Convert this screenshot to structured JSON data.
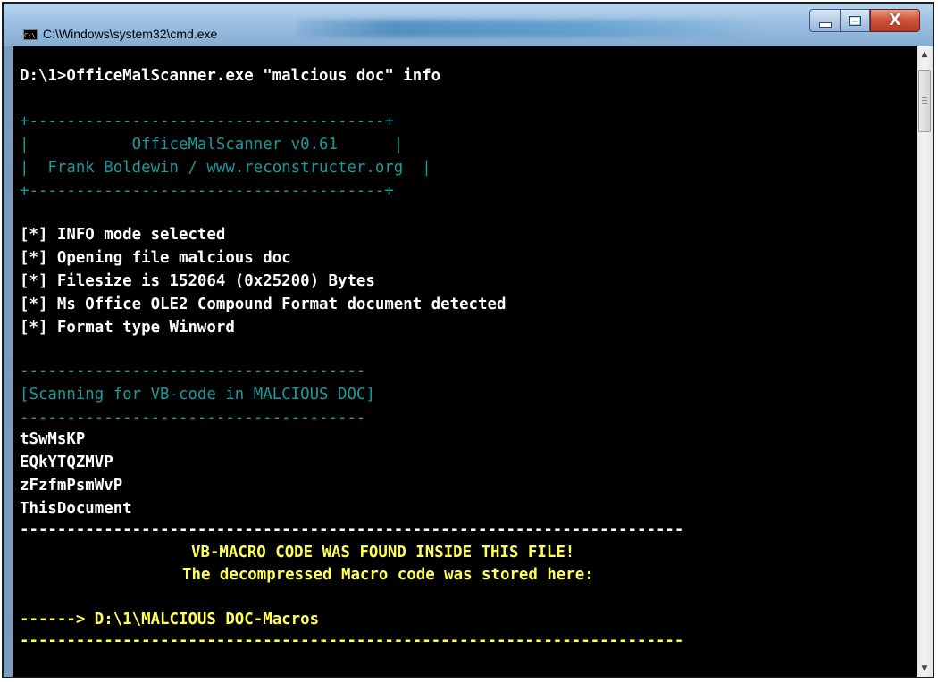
{
  "window": {
    "title": "C:\\Windows\\system32\\cmd.exe",
    "icon": "cmd-icon",
    "icon_text": "C:\\."
  },
  "controls": {
    "minimize_icon": "minimize-icon",
    "maximize_icon": "maximize-icon",
    "close_icon": "close-icon",
    "close_glyph": "X"
  },
  "scrollbar": {
    "up_arrow": "▲",
    "down_arrow": "▼"
  },
  "colors": {
    "console_bg": "#000000",
    "text": "#ffffff",
    "banner": "#1a9a9a",
    "highlight": "#ffff55"
  },
  "console": {
    "command": "D:\\1>OfficeMalScanner.exe \"malcious doc\" info",
    "banner": {
      "border_top": "+--------------------------------------+",
      "line1": "|           OfficeMalScanner v0.61      |",
      "line2": "|  Frank Boldewin / www.reconstructer.org  |",
      "border_bottom": "+--------------------------------------+"
    },
    "info_lines": [
      "[*] INFO mode selected",
      "[*] Opening file malcious doc",
      "[*] Filesize is 152064 (0x25200) Bytes",
      "[*] Ms Office OLE2 Compound Format document detected",
      "[*] Format type Winword"
    ],
    "scan_separator": "-------------------------------------",
    "scan_header": "[Scanning for VB-code in MALCIOUS DOC]",
    "modules": [
      "tSwMsKP",
      "EQkYTQZMVP",
      "zFzfmPsmWvP",
      "ThisDocument"
    ],
    "long_separator": "-----------------------------------------------------------------------",
    "found_message": "VB-MACRO CODE WAS FOUND INSIDE THIS FILE!",
    "stored_message": "The decompressed Macro code was stored here:",
    "output_path": "------> D:\\1\\MALCIOUS DOC-Macros"
  }
}
